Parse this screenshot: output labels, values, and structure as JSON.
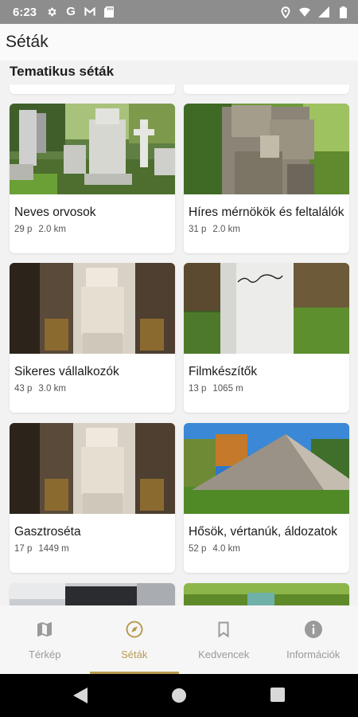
{
  "status_bar": {
    "time": "6:23",
    "icons": [
      "gear-icon",
      "google-icon",
      "gmail-icon",
      "sd-card-icon",
      "location-icon",
      "wifi-icon",
      "signal-icon",
      "battery-icon"
    ],
    "google_glyph": "G"
  },
  "app_bar": {
    "title": "Séták"
  },
  "section": {
    "title": "Tematikus séták"
  },
  "cards": [
    {
      "title": "Neves orvosok",
      "points": "29 p",
      "distance": "2.0 km"
    },
    {
      "title": "Híres mérnökök és feltalálók",
      "points": "31 p",
      "distance": "2.0 km"
    },
    {
      "title": "Sikeres vállalkozók",
      "points": "43 p",
      "distance": "3.0 km"
    },
    {
      "title": "Filmkészítők",
      "points": "13 p",
      "distance": "1065 m"
    },
    {
      "title": "Gasztroséta",
      "points": "17 p",
      "distance": "1449 m"
    },
    {
      "title": "Hősök, vértanúk, áldozatok",
      "points": "52 p",
      "distance": "4.0 km"
    }
  ],
  "bottom_nav": {
    "items": [
      {
        "label": "Térkép",
        "icon": "map-icon",
        "active": false
      },
      {
        "label": "Séták",
        "icon": "compass-icon",
        "active": true
      },
      {
        "label": "Kedvencek",
        "icon": "bookmark-icon",
        "active": false
      },
      {
        "label": "Információk",
        "icon": "info-icon",
        "active": false
      }
    ]
  },
  "colors": {
    "accent": "#b79b52",
    "inactive": "#9a9a9a",
    "status_bar": "#8d8d8d"
  }
}
